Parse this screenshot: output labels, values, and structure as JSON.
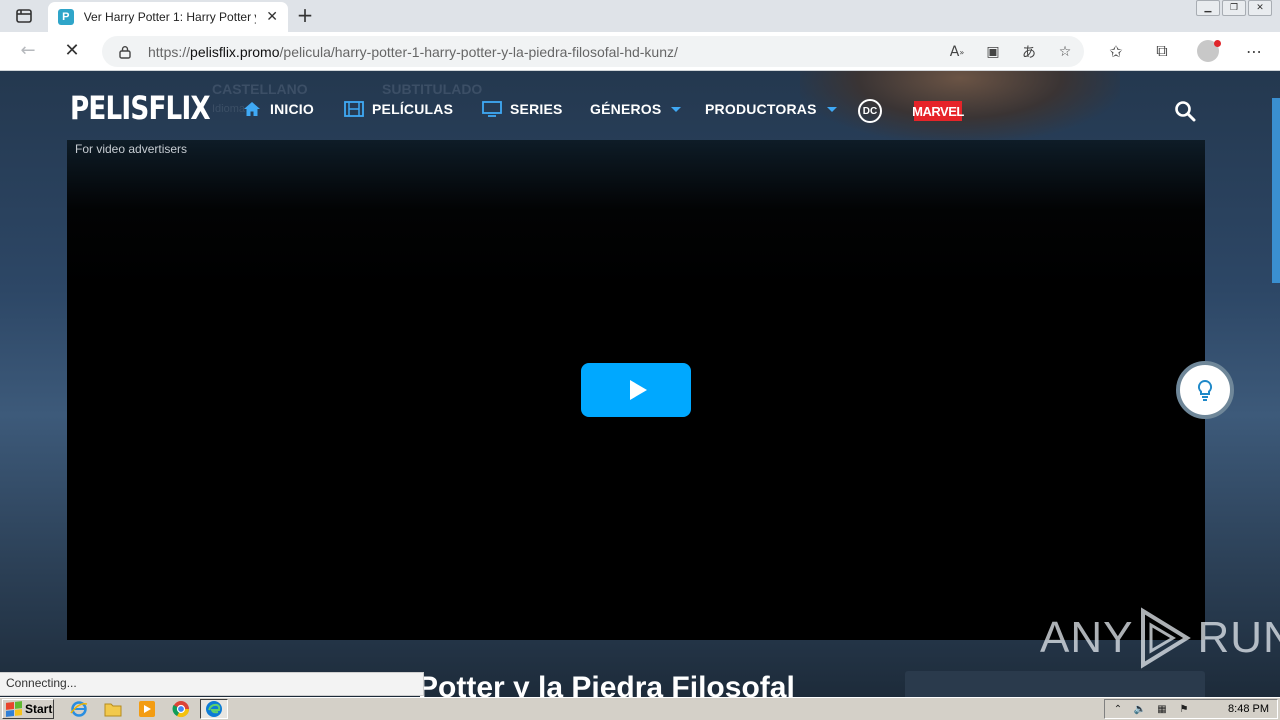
{
  "browser": {
    "tab_title": "Ver Harry Potter 1: Harry Potter y",
    "favicon_letter": "P",
    "url_prefix": "https://",
    "url_host": "pelisflix.promo",
    "url_path": "/pelicula/harry-potter-1-harry-potter-y-la-piedra-filosofal-hd-kunz/",
    "status_text": "Connecting..."
  },
  "site": {
    "logo": "PELISFLIX",
    "nav": {
      "home": "INICIO",
      "movies": "PELÍCULAS",
      "series": "SERIES",
      "genres": "GÉNEROS",
      "producers": "PRODUCTORAS"
    },
    "dc_label": "DC",
    "marvel_label": "MARVEL",
    "bg_language": "CASTELLANO",
    "bg_language_sub": "Idioma",
    "bg_subtitled": "SUBTITULADO",
    "player_advertiser_label": "For video advertisers",
    "movie_title": "Potter y la Piedra Filosofal",
    "accent_color": "#00a8ff"
  },
  "watermark": {
    "left": "ANY",
    "right": "RUN"
  },
  "taskbar": {
    "start_label": "Start",
    "clock": "8:48 PM"
  }
}
